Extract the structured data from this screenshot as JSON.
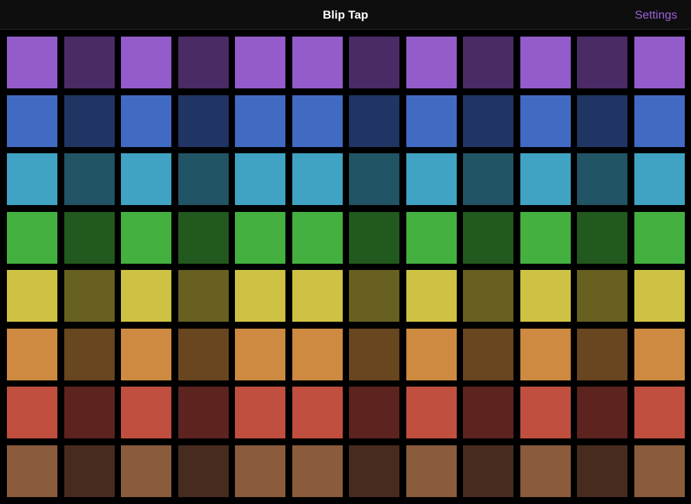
{
  "navbar": {
    "title": "Blip Tap",
    "settings_label": "Settings",
    "accent_color": "#9b62d8"
  },
  "grid": {
    "columns": 12,
    "rows": [
      {
        "name": "purple",
        "light": "#935cca",
        "dark": "#4b2b66"
      },
      {
        "name": "blue",
        "light": "#416ac3",
        "dark": "#213564"
      },
      {
        "name": "cyan",
        "light": "#40a3c3",
        "dark": "#215464"
      },
      {
        "name": "green",
        "light": "#44b040",
        "dark": "#21591e"
      },
      {
        "name": "yellow",
        "light": "#cdc243",
        "dark": "#676020"
      },
      {
        "name": "orange",
        "light": "#cd8a40",
        "dark": "#68461f"
      },
      {
        "name": "red",
        "light": "#c04f40",
        "dark": "#5d241f"
      },
      {
        "name": "brown",
        "light": "#8a5c3c",
        "dark": "#472b1f"
      }
    ],
    "pattern": [
      "light",
      "dark",
      "light",
      "dark",
      "light",
      "light",
      "dark",
      "light",
      "dark",
      "light",
      "dark",
      "light"
    ]
  }
}
